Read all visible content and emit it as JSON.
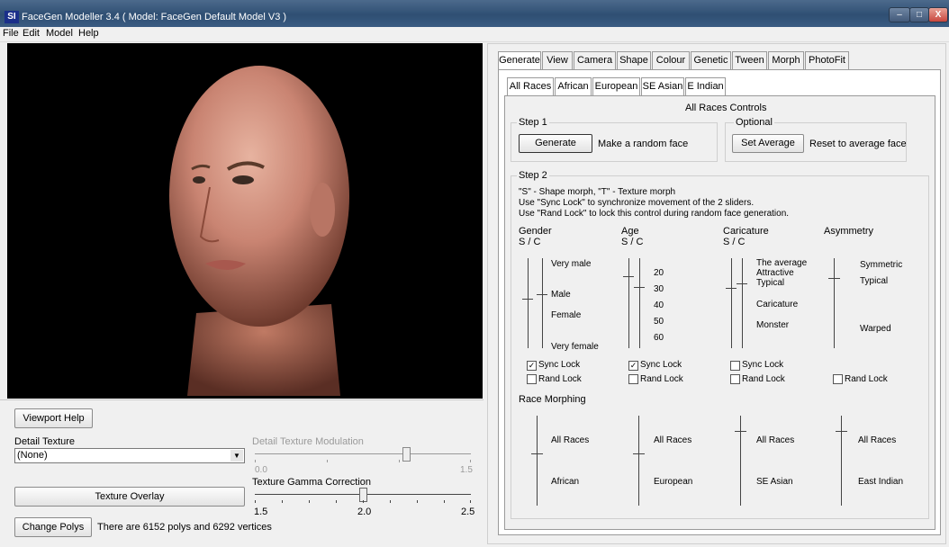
{
  "window": {
    "title": "FaceGen Modeller 3.4  ( Model: FaceGen Default Model V3 )",
    "logo": "SI",
    "minimize": "–",
    "maximize": "□",
    "close": "X"
  },
  "menu": [
    "File",
    "Edit",
    "Model",
    "Help"
  ],
  "bottom_panel": {
    "viewport_help": "Viewport Help",
    "detail_texture_label": "Detail Texture",
    "detail_texture_value": "(None)",
    "detail_mod_label": "Detail Texture Modulation",
    "detail_mod_min": "0.0",
    "detail_mod_max": "1.5",
    "detail_mod_value": 1.05,
    "texture_overlay": "Texture Overlay",
    "gamma_label": "Texture Gamma Correction",
    "gamma_min": "1.5",
    "gamma_mid": "2.0",
    "gamma_max": "2.5",
    "gamma_value": 2.0,
    "change_polys": "Change Polys",
    "polys_info": "There are 6152 polys and 6292 vertices"
  },
  "tabs": [
    "Generate",
    "View",
    "Camera",
    "Shape",
    "Colour",
    "Genetic",
    "Tween",
    "Morph",
    "PhotoFit"
  ],
  "subtabs": [
    "All Races",
    "African",
    "European",
    "SE Asian",
    "E Indian"
  ],
  "panel": {
    "heading": "All Races Controls",
    "step1": "Step 1",
    "generate_btn": "Generate",
    "generate_desc": "Make a random face",
    "optional": "Optional",
    "set_average_btn": "Set Average",
    "set_average_desc": "Reset to average face",
    "step2": "Step 2",
    "help1": "\"S\" - Shape morph, \"T\" - Texture morph",
    "help2": "Use \"Sync Lock\" to synchronize movement of the 2 sliders.",
    "help3": "Use \"Rand Lock\" to lock this control during random face generation.",
    "controls": [
      {
        "name": "Gender",
        "sub": "S / C",
        "labels": [
          "Very male",
          "Male",
          "Female",
          "Very female"
        ],
        "sync_lock": "Sync Lock",
        "sync_checked": true,
        "rand_lock": "Rand Lock"
      },
      {
        "name": "Age",
        "sub": "S / C",
        "labels": [
          "20",
          "30",
          "40",
          "50",
          "60"
        ],
        "sync_lock": "Sync Lock",
        "sync_checked": true,
        "rand_lock": "Rand Lock"
      },
      {
        "name": "Caricature",
        "sub": "S / C",
        "labels": [
          "The average",
          "Attractive",
          "Typical",
          "Caricature",
          "Monster"
        ],
        "sync_lock": "Sync Lock",
        "sync_checked": false,
        "rand_lock": "Rand Lock"
      },
      {
        "name": "Asymmetry",
        "sub": "",
        "labels": [
          "Symmetric",
          "Typical",
          "Warped"
        ],
        "rand_lock": "Rand Lock"
      }
    ],
    "race_morphing": "Race Morphing",
    "races": [
      {
        "top": "All Races",
        "bottom": "African"
      },
      {
        "top": "All Races",
        "bottom": "European"
      },
      {
        "top": "All Races",
        "bottom": "SE Asian"
      },
      {
        "top": "All Races",
        "bottom": "East Indian"
      }
    ]
  },
  "colors": {
    "title_bar": "#2f4f73",
    "close_button": "#c9463d",
    "viewport_bg": "#000000"
  }
}
